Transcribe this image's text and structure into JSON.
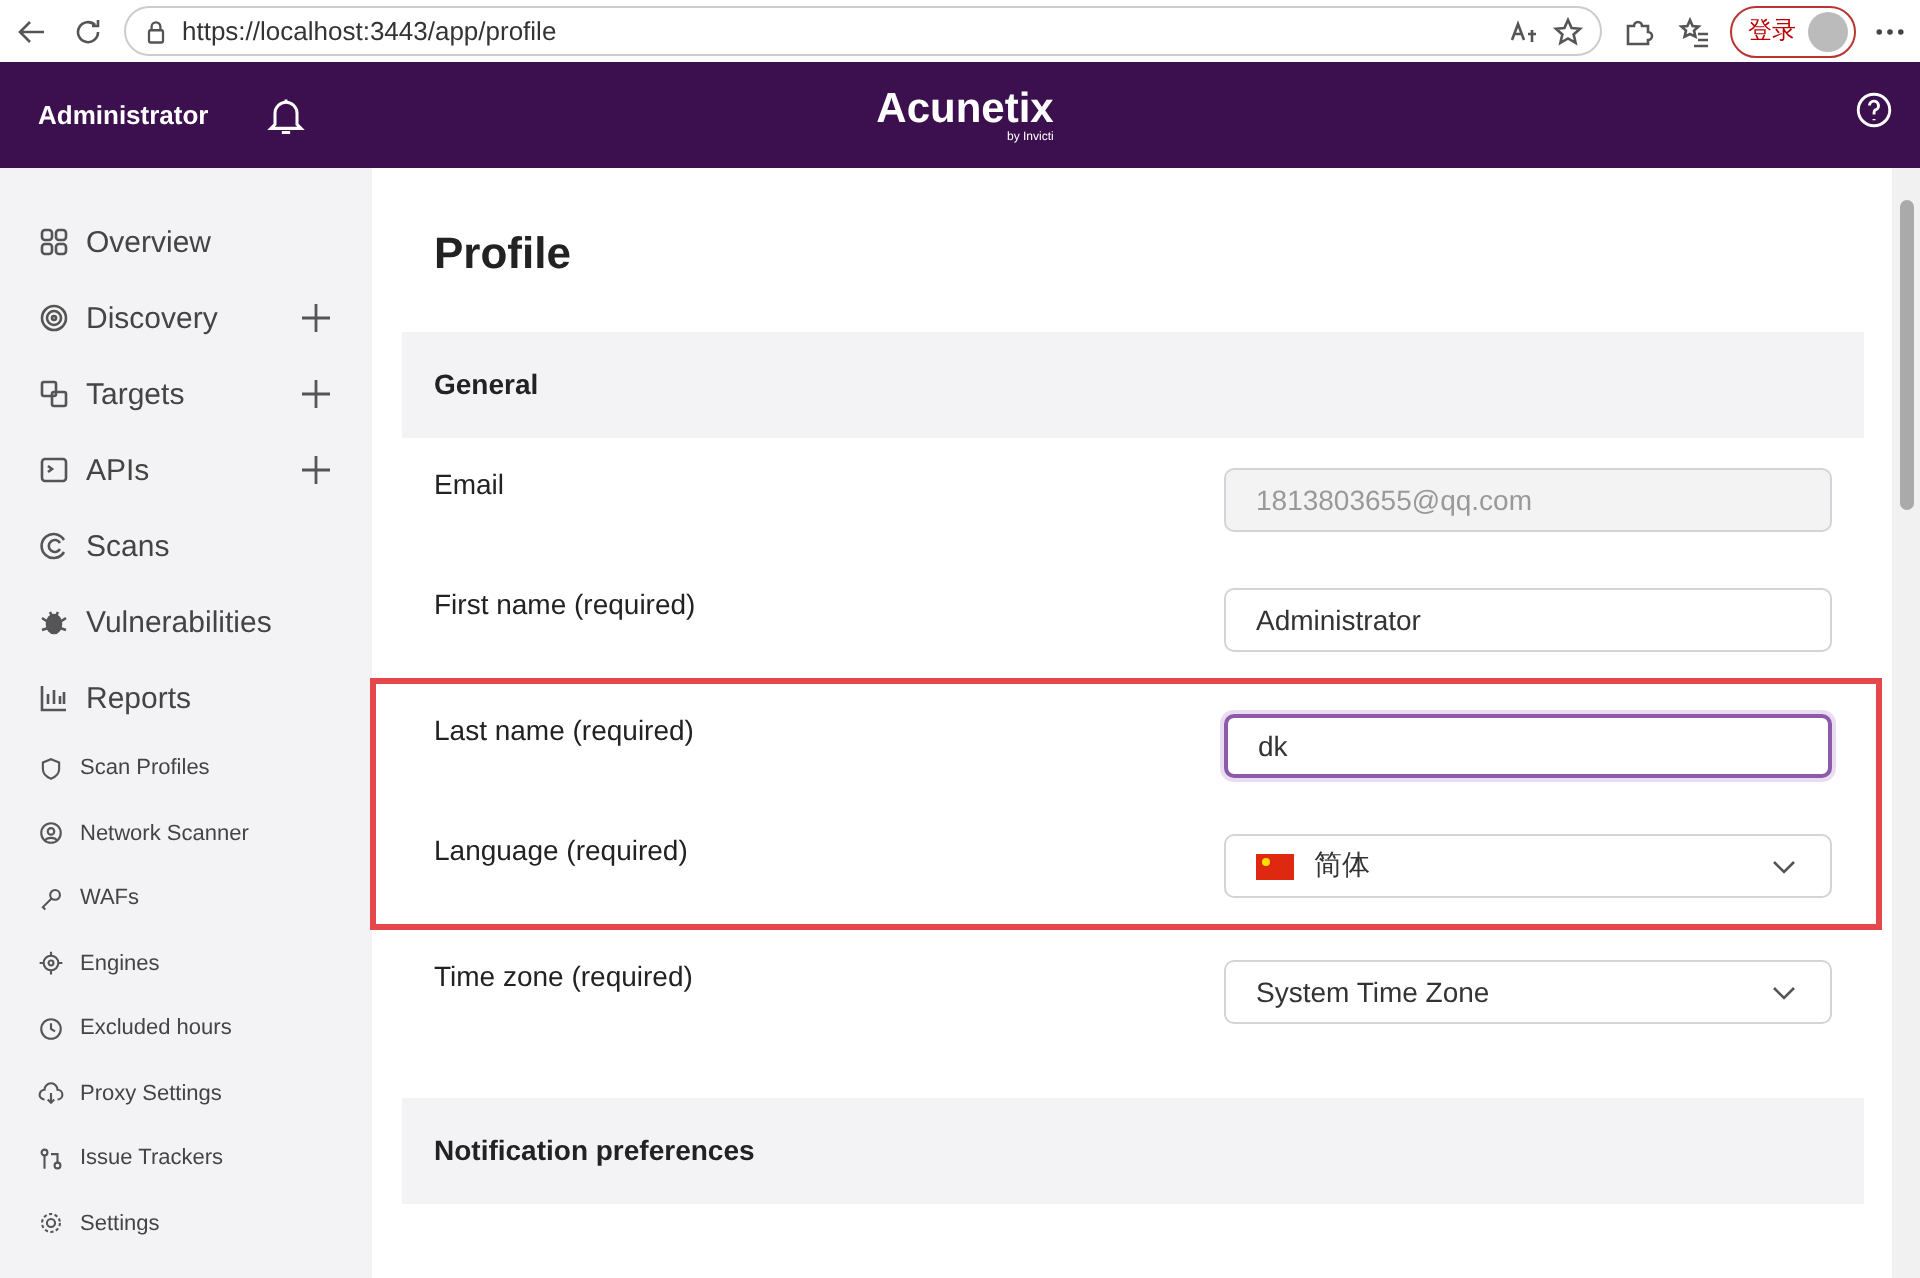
{
  "browser": {
    "url": "https://localhost:3443/app/profile",
    "login_button": "登录"
  },
  "header": {
    "user": "Administrator",
    "logo": "Acunetix",
    "logo_sub": "by Invicti"
  },
  "sidebar": {
    "items": [
      {
        "label": "Overview",
        "kind": "main",
        "has_add": false
      },
      {
        "label": "Discovery",
        "kind": "main",
        "has_add": true
      },
      {
        "label": "Targets",
        "kind": "main",
        "has_add": true
      },
      {
        "label": "APIs",
        "kind": "main",
        "has_add": true
      },
      {
        "label": "Scans",
        "kind": "main",
        "has_add": false
      },
      {
        "label": "Vulnerabilities",
        "kind": "main",
        "has_add": false
      },
      {
        "label": "Reports",
        "kind": "main",
        "has_add": false
      },
      {
        "label": "Scan Profiles",
        "kind": "sub",
        "has_add": false
      },
      {
        "label": "Network Scanner",
        "kind": "sub",
        "has_add": false
      },
      {
        "label": "WAFs",
        "kind": "sub",
        "has_add": false
      },
      {
        "label": "Engines",
        "kind": "sub",
        "has_add": false
      },
      {
        "label": "Excluded hours",
        "kind": "sub",
        "has_add": false
      },
      {
        "label": "Proxy Settings",
        "kind": "sub",
        "has_add": false
      },
      {
        "label": "Issue Trackers",
        "kind": "sub",
        "has_add": false
      },
      {
        "label": "Settings",
        "kind": "sub",
        "has_add": false
      }
    ]
  },
  "page": {
    "title": "Profile",
    "general": {
      "heading": "General",
      "rows": [
        {
          "label": "Email",
          "kind": "text",
          "value": "1813803655@qq.com",
          "disabled": true,
          "focused": false,
          "highlighted": false
        },
        {
          "label": "First name (required)",
          "kind": "text",
          "value": "Administrator",
          "disabled": false,
          "focused": false,
          "highlighted": false
        },
        {
          "label": "Last name (required)",
          "kind": "text",
          "value": "dk",
          "disabled": false,
          "focused": true,
          "highlighted": true
        },
        {
          "label": "Language (required)",
          "kind": "flag-select",
          "value": "简体",
          "disabled": false,
          "focused": false,
          "highlighted": true
        },
        {
          "label": "Time zone (required)",
          "kind": "select",
          "value": "System Time Zone",
          "disabled": false,
          "focused": false,
          "highlighted": false
        }
      ]
    },
    "notifications": {
      "heading": "Notification preferences"
    }
  }
}
